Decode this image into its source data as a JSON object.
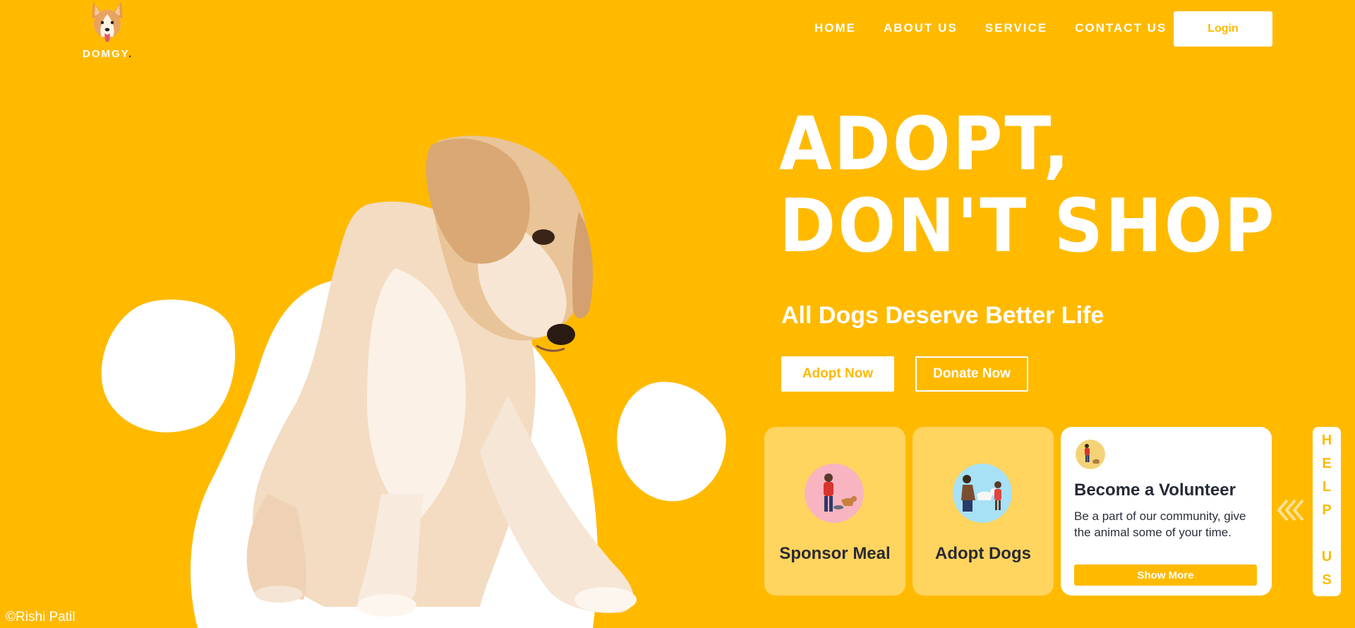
{
  "brand": {
    "name": "DOMGY",
    "dot": "."
  },
  "nav": {
    "items": [
      {
        "label": "HOME"
      },
      {
        "label": "ABOUT US"
      },
      {
        "label": "SERVICE"
      },
      {
        "label": "CONTACT US"
      }
    ],
    "login_label": "Login"
  },
  "hero": {
    "title_line1": "ADOPT,",
    "title_line2": "DON'T SHOP",
    "tagline": "All Dogs Deserve Better Life",
    "adopt_label": "Adopt Now",
    "donate_label": "Donate Now"
  },
  "cards": {
    "sponsor": {
      "label": "Sponsor Meal",
      "icon": "sponsor-meal-illustration"
    },
    "adopt": {
      "label": "Adopt Dogs",
      "icon": "adopt-dogs-illustration"
    },
    "volunteer": {
      "title": "Become a Volunteer",
      "description": "Be a part of our community, give the animal some of your time.",
      "button_label": "Show More",
      "icon": "volunteer-avatar"
    }
  },
  "help_tab": {
    "letters": [
      "H",
      "E",
      "L",
      "P",
      "U",
      "S"
    ],
    "icon": "chevrons-left-icon"
  },
  "footer": {
    "credit": "©Rishi Patil"
  },
  "colors": {
    "accent": "#FFBA00",
    "card": "#FFD45F",
    "white": "#FFFFFF",
    "text_dark": "#252A36"
  }
}
